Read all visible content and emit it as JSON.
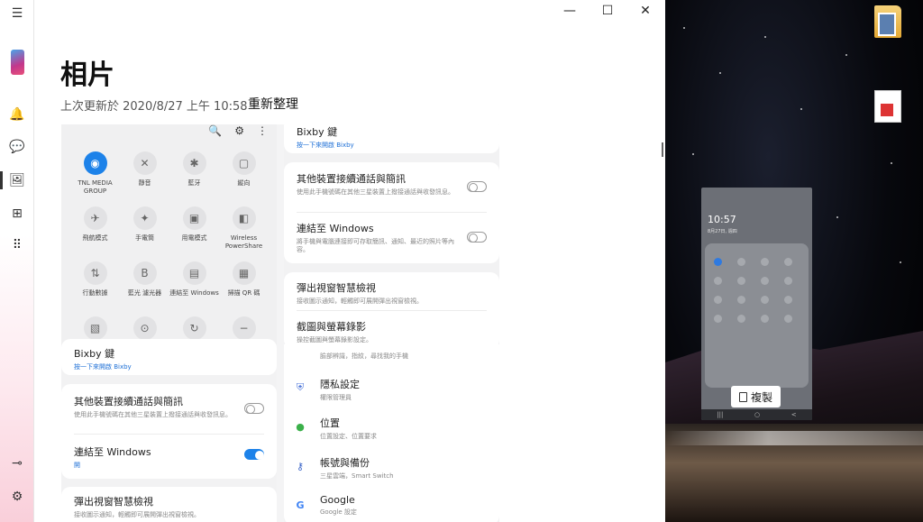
{
  "window": {
    "title": "相片",
    "updated": "上次更新於 2020/8/27 上午 10:58",
    "refresh": "重新整理",
    "controls": {
      "minimize": "—",
      "maximize": "☐",
      "close": "✕"
    }
  },
  "rail": {
    "menu_icon": "☰",
    "icons": {
      "notifications": "🔔",
      "messages": "💬",
      "photos": "🖼",
      "apps": "⊞",
      "calls": "⠿",
      "pin": "⊸",
      "settings": "⚙"
    }
  },
  "quick_panel": {
    "top_icons": {
      "search": "🔍",
      "settings": "⚙",
      "more": "⋮"
    },
    "tiles": [
      {
        "label": "TNL MEDIA GROUP",
        "glyph": "◉",
        "on": true
      },
      {
        "label": "靜音",
        "glyph": "✕",
        "on": false
      },
      {
        "label": "藍牙",
        "glyph": "✱",
        "on": false
      },
      {
        "label": "縱向",
        "glyph": "▢",
        "on": false
      },
      {
        "label": "飛航模式",
        "glyph": "✈",
        "on": false
      },
      {
        "label": "手電筒",
        "glyph": "✦",
        "on": false
      },
      {
        "label": "用電模式",
        "glyph": "▣",
        "on": false
      },
      {
        "label": "Wireless PowerShare",
        "glyph": "◧",
        "on": false
      },
      {
        "label": "行動數據",
        "glyph": "⇅",
        "on": false
      },
      {
        "label": "藍光 濾光器",
        "glyph": "B",
        "on": false
      },
      {
        "label": "連結至 Windows",
        "glyph": "▤",
        "on": false
      },
      {
        "label": "掃描 QR 碼",
        "glyph": "▦",
        "on": false
      },
      {
        "label": "",
        "glyph": "▧",
        "on": false
      },
      {
        "label": "",
        "glyph": "⊙",
        "on": false
      },
      {
        "label": "",
        "glyph": "↻",
        "on": false
      },
      {
        "label": "",
        "glyph": "−",
        "on": false
      }
    ]
  },
  "left_settings": {
    "bixby_title": "Bixby 鍵",
    "bixby_sub": "按一下來開啟 Bixby",
    "continue_title": "其他裝置接續通話與簡訊",
    "continue_sub": "使用此手機號碼在其他三星裝置上撥接通話與收發訊息。",
    "link_title": "連結至 Windows",
    "link_sub": "開",
    "popup_title": "彈出視窗智慧檢視",
    "popup_sub": "接收圖示通知，輕觸即可展開彈出視窗檢視。"
  },
  "right_settings": {
    "bixby_title": "Bixby 鍵",
    "bixby_sub": "按一下來開啟 Bixby",
    "continue_title": "其他裝置接續通話與簡訊",
    "continue_sub": "使用此手機號碼在其他三星裝置上撥接通話與收發訊息。",
    "link_title": "連結至 Windows",
    "link_sub": "將手機與電腦連接即可存取簡訊、通知、最近的照片等內容。",
    "popup_title": "彈出視窗智慧檢視",
    "popup_sub": "接收圖示通知，輕觸即可展開彈出視窗檢視。",
    "capture_title": "截圖與螢幕錄影",
    "capture_sub": "操控截圖與螢幕錄影設定。",
    "biometrics_sub": "臉部辨識，指紋，尋找我的手機",
    "privacy_title": "隱私設定",
    "privacy_sub": "權限管理員",
    "location_title": "位置",
    "location_sub": "位置設定、位置要求",
    "accounts_title": "帳號與備份",
    "accounts_sub": "三星雲端，Smart Switch",
    "google_title": "Google",
    "google_sub": "Google 設定"
  },
  "phone_mirror": {
    "time": "10:57",
    "date": "8月27日, 週四",
    "copy_label": "複製",
    "nav": {
      "recent": "|||",
      "home": "○",
      "back": "<"
    }
  }
}
